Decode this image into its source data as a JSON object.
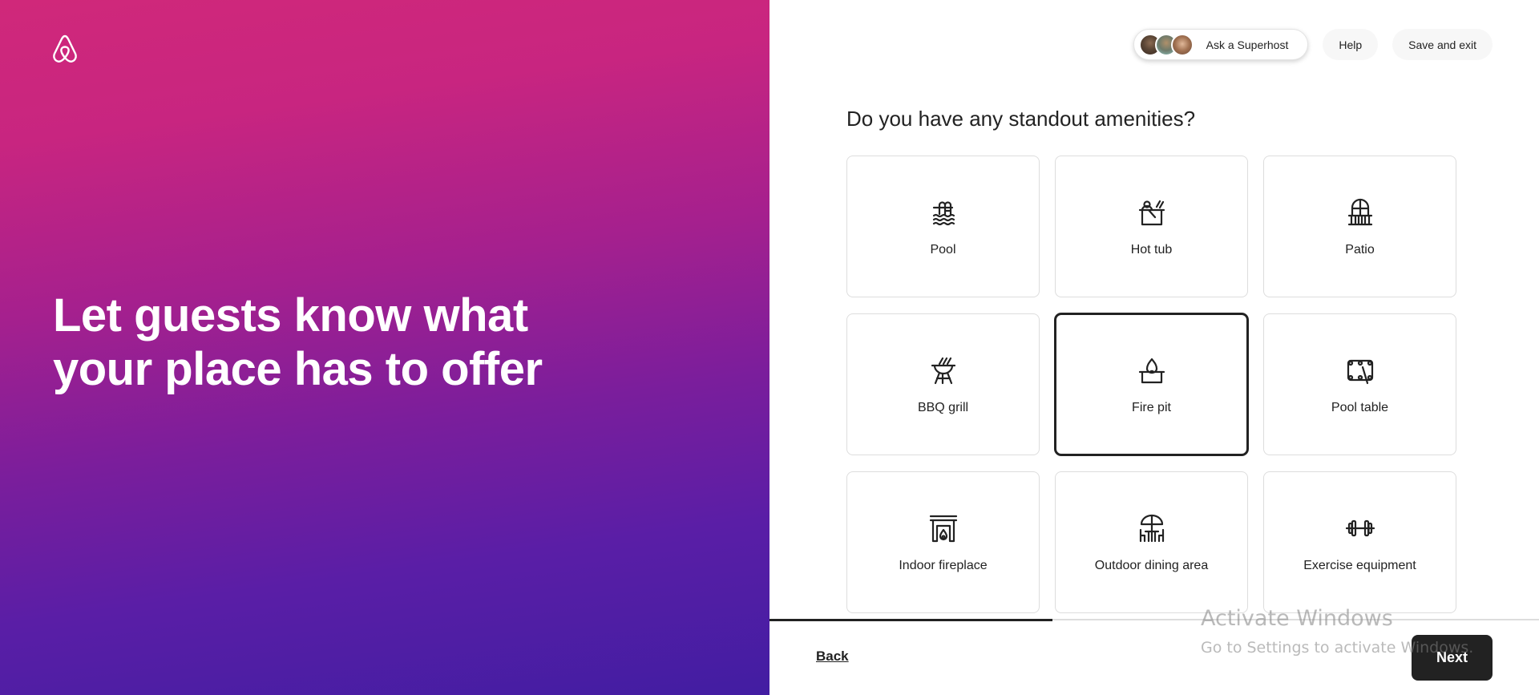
{
  "brand": {
    "logo_icon": "airbnb-logo-icon",
    "gradient_colors": [
      "#d0287a",
      "#a5208e",
      "#5a1ea6",
      "#421da2"
    ]
  },
  "hero": {
    "title": "Let guests know what your place has to offer"
  },
  "header": {
    "ask_superhost_label": "Ask a Superhost",
    "help_label": "Help",
    "save_exit_label": "Save and exit"
  },
  "main": {
    "question": "Do you have any standout amenities?",
    "amenities": [
      {
        "label": "Pool",
        "icon": "pool-icon",
        "selected": false
      },
      {
        "label": "Hot tub",
        "icon": "hot-tub-icon",
        "selected": false
      },
      {
        "label": "Patio",
        "icon": "patio-icon",
        "selected": false
      },
      {
        "label": "BBQ grill",
        "icon": "bbq-grill-icon",
        "selected": false
      },
      {
        "label": "Fire pit",
        "icon": "fire-pit-icon",
        "selected": true
      },
      {
        "label": "Pool table",
        "icon": "pool-table-icon",
        "selected": false
      },
      {
        "label": "Indoor fireplace",
        "icon": "indoor-fireplace-icon",
        "selected": false
      },
      {
        "label": "Outdoor dining area",
        "icon": "outdoor-dining-icon",
        "selected": false
      },
      {
        "label": "Exercise equipment",
        "icon": "exercise-equipment-icon",
        "selected": false
      }
    ]
  },
  "footer": {
    "progress_fraction": 0.368,
    "back_label": "Back",
    "next_label": "Next"
  },
  "watermark": {
    "title": "Activate Windows",
    "subtitle": "Go to Settings to activate Windows."
  }
}
